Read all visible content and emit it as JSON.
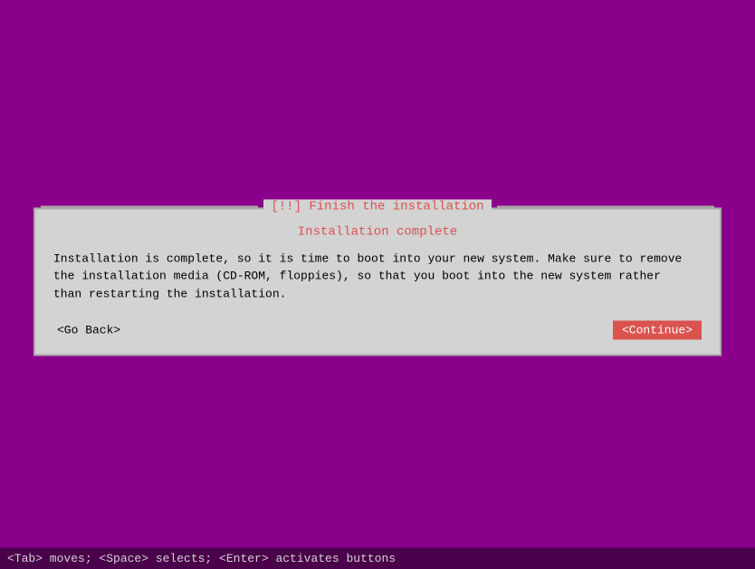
{
  "dialog": {
    "title": "[!!] Finish the installation",
    "subtitle": "Installation complete",
    "message_line1": "Installation is complete, so it is time to boot into your new system. Make sure to remove",
    "message_line2": "the installation media (CD-ROM, floppies), so that you boot into the new system rather",
    "message_line3": "than restarting the installation.",
    "btn_go_back": "<Go Back>",
    "btn_continue": "<Continue>"
  },
  "status_bar": {
    "text": "<Tab> moves; <Space> selects; <Enter> activates buttons"
  },
  "colors": {
    "background": "#8b008b",
    "dialog_bg": "#d3d3d3",
    "title_color": "#d9534f",
    "continue_btn_bg": "#d9534f",
    "continue_btn_text": "#ffffff",
    "status_bar_bg": "#4a004a",
    "status_bar_text": "#d3d3d3"
  }
}
